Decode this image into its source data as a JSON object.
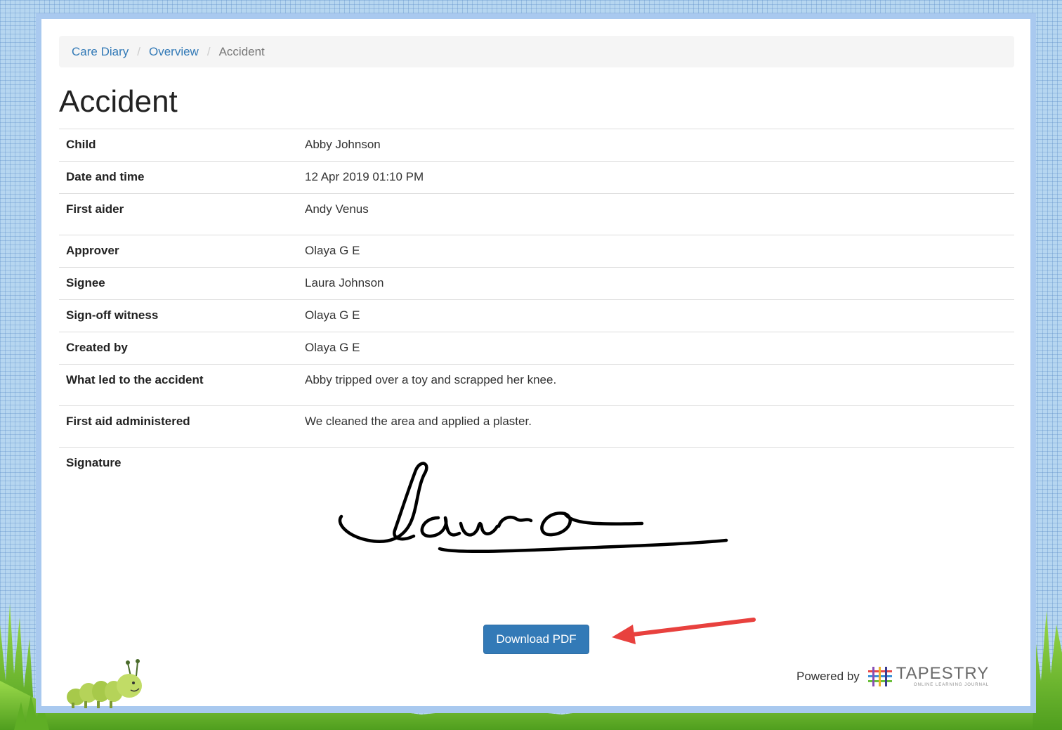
{
  "breadcrumb": {
    "items": [
      "Care Diary",
      "Overview"
    ],
    "separator": "/",
    "current": "Accident"
  },
  "page_title": "Accident",
  "details": [
    {
      "label": "Child",
      "value": "Abby Johnson"
    },
    {
      "label": "Date and time",
      "value": "12 Apr 2019 01:10 PM"
    },
    {
      "label": "First aider",
      "value": "Andy Venus"
    },
    {
      "label": "Approver",
      "value": "Olaya G E"
    },
    {
      "label": "Signee",
      "value": "Laura Johnson"
    },
    {
      "label": "Sign-off witness",
      "value": "Olaya G E"
    },
    {
      "label": "Created by",
      "value": "Olaya G E"
    },
    {
      "label": "What led to the accident",
      "value": "Abby tripped over a toy and scrapped her knee."
    },
    {
      "label": "First aid administered",
      "value": "We cleaned the area and applied a plaster."
    }
  ],
  "signature": {
    "label": "Signature",
    "handwriting": "Laura"
  },
  "download_button": "Download PDF",
  "footer": {
    "powered_by": "Powered by",
    "brand": "TAPESTRY",
    "brand_tagline": "ONLINE LEARNING JOURNAL"
  },
  "colors": {
    "link": "#337ab7",
    "button": "#337ab7",
    "arrow": "#e8413e",
    "frame": "#a9c9ef",
    "background": "#b6d6f0",
    "grass": "#7cc832"
  },
  "icons": [
    "caterpillar-icon",
    "tapestry-logo-icon",
    "red-arrow-icon"
  ]
}
